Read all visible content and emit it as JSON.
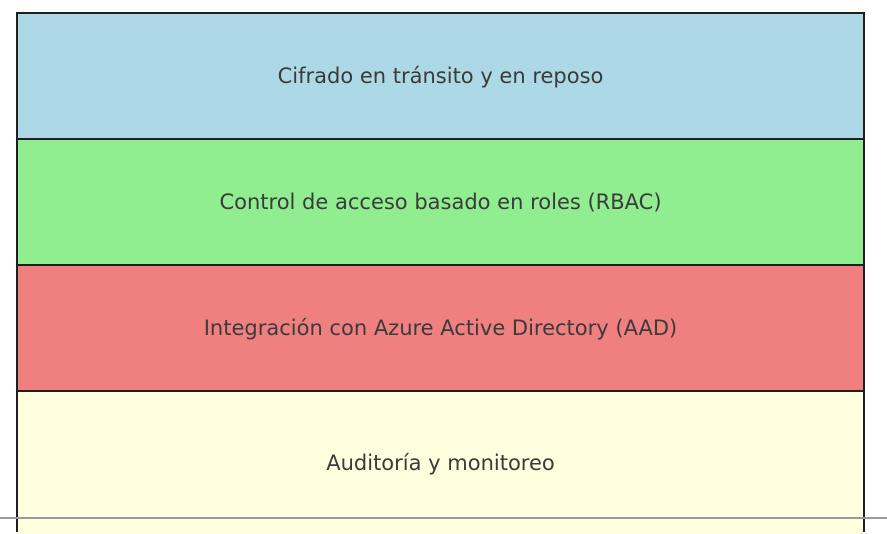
{
  "layers": [
    {
      "label": "Cifrado en tránsito y en reposo",
      "color": "#add8e6"
    },
    {
      "label": "Control de acceso basado en roles (RBAC)",
      "color": "#90ee90"
    },
    {
      "label": "Integración con Azure Active Directory (AAD)",
      "color": "#f08080"
    },
    {
      "label": "Auditoría y monitoreo",
      "color": "#ffffe0"
    }
  ]
}
